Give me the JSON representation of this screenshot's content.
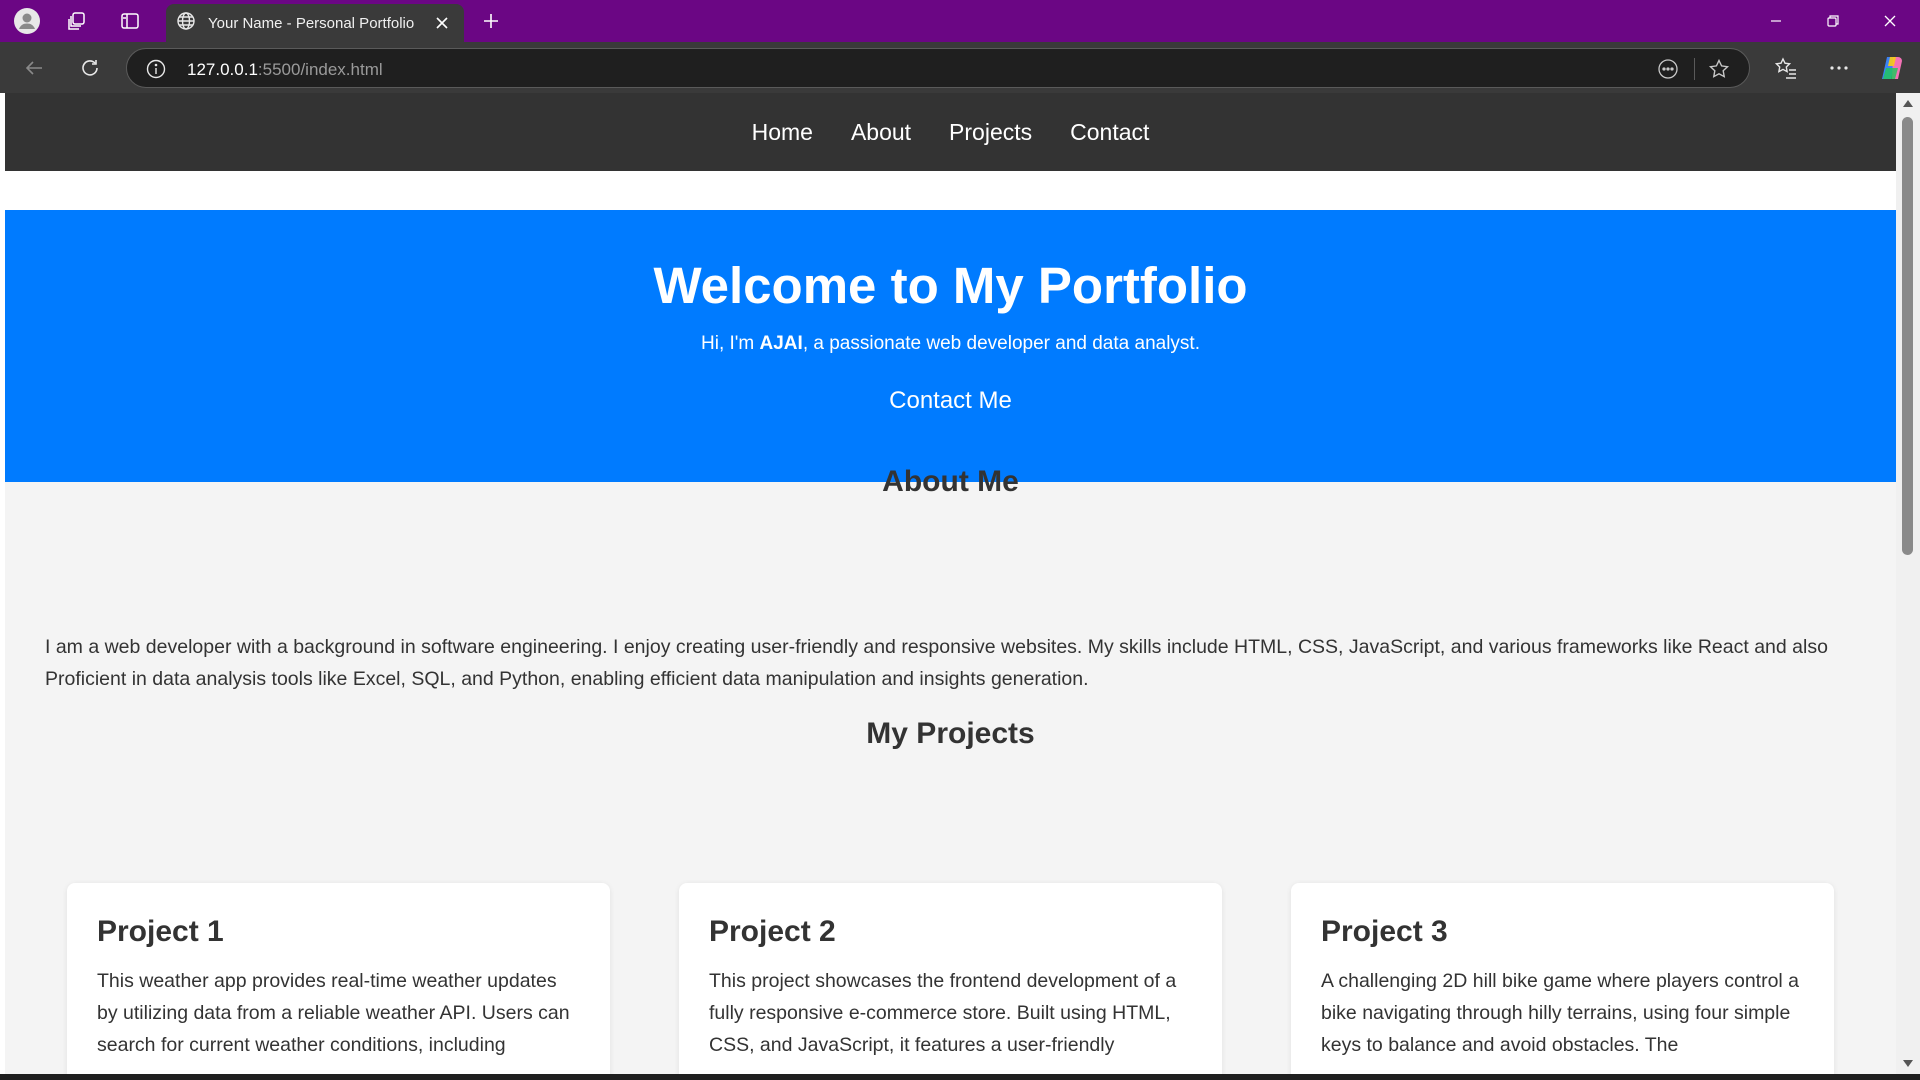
{
  "browser": {
    "tab_title": "Your Name - Personal Portfolio",
    "url_host": "127.0.0.1",
    "url_path": ":5500/index.html",
    "titlebar_color": "#6b0684"
  },
  "site": {
    "nav": [
      "Home",
      "About",
      "Projects",
      "Contact"
    ],
    "hero": {
      "title": "Welcome to My Portfolio",
      "intro_before": "Hi, I'm ",
      "name": "AJAI",
      "intro_after": ", a passionate web developer and data analyst.",
      "cta": "Contact Me",
      "color": "#007bff"
    },
    "about": {
      "title": "About Me",
      "text": "I am a web developer with a background in software engineering. I enjoy creating user-friendly and responsive websites. My skills include HTML, CSS, JavaScript, and various frameworks like React and also Proficient in data analysis tools like Excel, SQL, and Python, enabling efficient data manipulation and insights generation."
    },
    "projects": {
      "title": "My Projects",
      "items": [
        {
          "title": "Project 1",
          "text": "This weather app provides real-time weather updates by utilizing data from a reliable weather API. Users can search for current weather conditions, including"
        },
        {
          "title": "Project 2",
          "text": "This project showcases the frontend development of a fully responsive e-commerce store. Built using HTML, CSS, and JavaScript, it features a user-friendly"
        },
        {
          "title": "Project 3",
          "text": "A challenging 2D hill bike game where players control a bike navigating through hilly terrains, using four simple keys to balance and avoid obstacles. The"
        }
      ]
    }
  }
}
